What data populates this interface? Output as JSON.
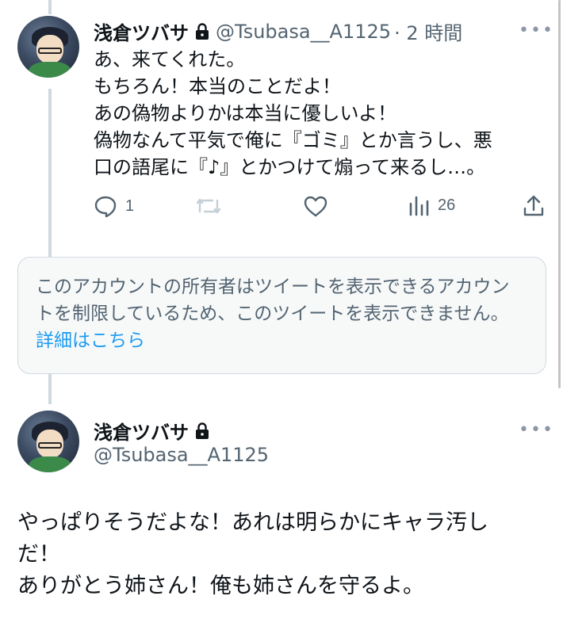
{
  "reply_tweet": {
    "display_name": "浅倉ツバサ",
    "handle": "@Tsubasa__A1125",
    "time": "· 2 時間",
    "more": "•••",
    "text": "あ、来てくれた。\nもちろん！本当のことだよ！\nあの偽物よりかは本当に優しいよ！\n偽物なんて平気で俺に『ゴミ』とか言うし、悪\n口の語尾に『♪』とかつけて煽って来るし…。",
    "actions": {
      "reply_count": "1",
      "retweet_count": "",
      "like_count": "",
      "views_count": "26"
    }
  },
  "restricted_notice": {
    "text": "このアカウントの所有者はツイートを表示できるアカウントを制限しているため、このツイートを表示できません。",
    "link": "詳細はこちら"
  },
  "main_tweet": {
    "display_name": "浅倉ツバサ",
    "handle": "@Tsubasa__A1125",
    "more": "•••",
    "text": "やっぱりそうだよな！あれは明らかにキャラ汚し\nだ！\nありがとう姉さん！俺も姉さんを守るよ。"
  },
  "colors": {
    "text": "#0f1419",
    "secondary": "#536471",
    "link": "#1d9bf0",
    "border": "#cfd9de",
    "notice_bg": "#f7f9f9"
  },
  "icons": {
    "lock": "lock-icon",
    "reply": "reply-icon",
    "retweet": "retweet-icon",
    "like": "heart-icon",
    "views": "views-icon",
    "share": "share-icon",
    "more": "more-icon"
  }
}
